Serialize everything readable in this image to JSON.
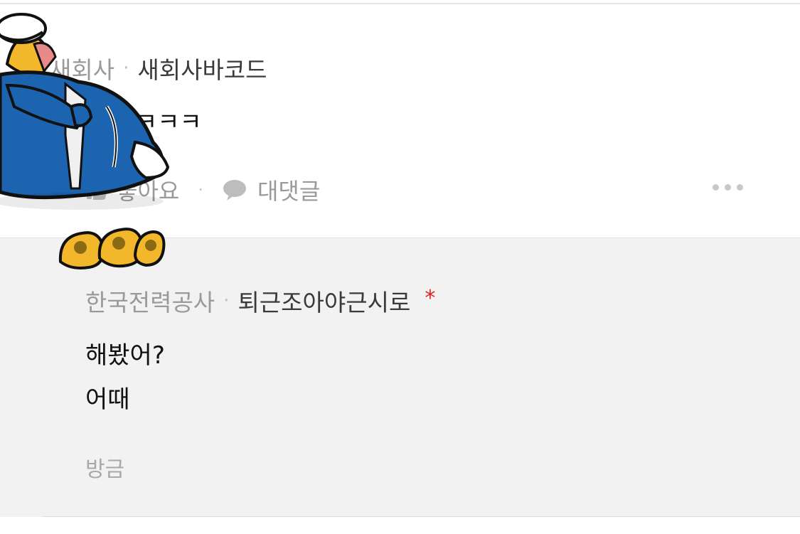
{
  "comment": {
    "company": "새회사",
    "separator": "·",
    "nickname": "새회사바코드",
    "body": "ㅋㅋㅋ",
    "like_label": "좋아요",
    "action_separator": "·",
    "reply_label": "대댓글"
  },
  "reply": {
    "company": "한국전력공사",
    "separator": "·",
    "nickname": "퇴근조아야근시로",
    "writer_mark": "*",
    "body_lines": [
      "해봤어?",
      "어때"
    ],
    "time": "방금"
  },
  "sticker": {
    "icon": "crouching-character-sticker-icon",
    "colors": {
      "suit": "#1c63b0",
      "hair": "#f2b72a",
      "outline": "#111111"
    }
  },
  "colors": {
    "background": "#ffffff",
    "reply_background": "#f2f2f2",
    "writer_mark": "#e02424",
    "muted_text": "#9a9a9a"
  }
}
